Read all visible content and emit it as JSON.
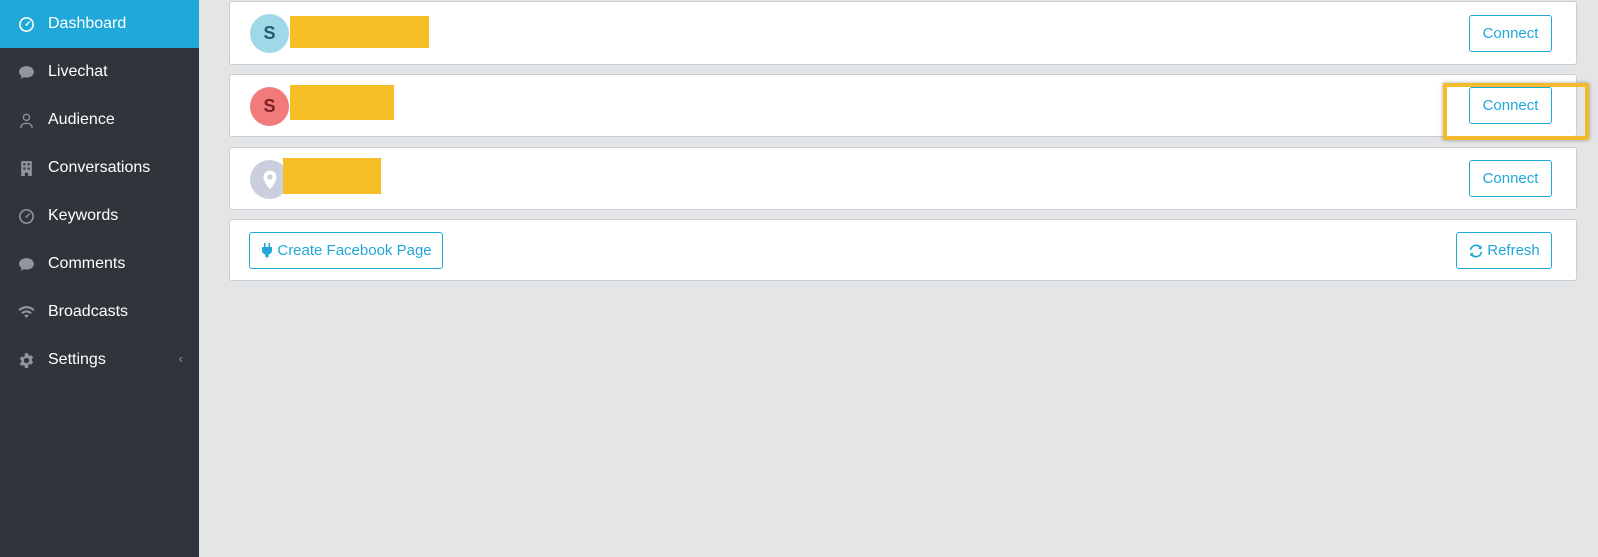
{
  "sidebar": {
    "items": [
      {
        "label": "Dashboard",
        "icon": "speedometer-icon",
        "active": true
      },
      {
        "label": "Livechat",
        "icon": "chat-bubble-icon"
      },
      {
        "label": "Audience",
        "icon": "user-icon"
      },
      {
        "label": "Conversations",
        "icon": "building-icon"
      },
      {
        "label": "Keywords",
        "icon": "speedometer-icon"
      },
      {
        "label": "Comments",
        "icon": "chat-bubble-icon"
      },
      {
        "label": "Broadcasts",
        "icon": "wifi-icon"
      },
      {
        "label": "Settings",
        "icon": "gear-icon",
        "caret": "‹"
      }
    ]
  },
  "pages": [
    {
      "avatar_letter": "S",
      "avatar_bg": "#9fd8e6",
      "avatar_fg": "#1f5a75",
      "connect_label": "Connect"
    },
    {
      "avatar_letter": "S",
      "avatar_bg": "#f07b7a",
      "avatar_fg": "#7a1f24",
      "connect_label": "Connect"
    },
    {
      "avatar_letter": "",
      "avatar_icon": "map-pin-icon",
      "avatar_bg": "#c9cfdd",
      "connect_label": "Connect"
    }
  ],
  "footer": {
    "create_label": "Create Facebook Page",
    "refresh_label": "Refresh"
  },
  "colors": {
    "accent": "#20a8d8",
    "sidebar_bg": "#2f353b",
    "redaction": "#f6be26",
    "highlight": "#f2bb2d"
  }
}
